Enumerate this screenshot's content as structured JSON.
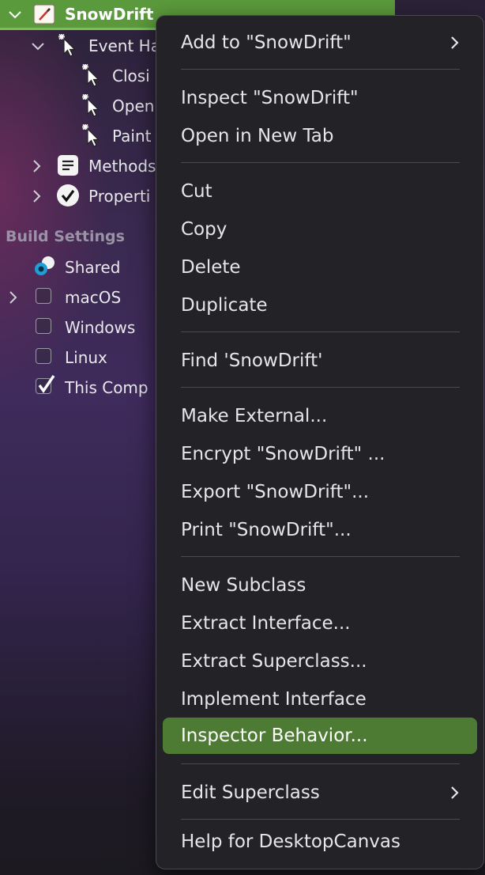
{
  "tree": {
    "project": "SnowDrift",
    "children": [
      {
        "label": "Event Ha"
      },
      {
        "label": "Closi"
      },
      {
        "label": "Open"
      },
      {
        "label": "Paint"
      },
      {
        "label": "Methods"
      },
      {
        "label": "Properti"
      }
    ],
    "build_settings_header": "Build Settings",
    "build_items": [
      {
        "label": "Shared",
        "checked": null
      },
      {
        "label": "macOS",
        "checked": false
      },
      {
        "label": "Windows",
        "checked": false
      },
      {
        "label": "Linux",
        "checked": false
      },
      {
        "label": "This Comp",
        "checked": true
      }
    ]
  },
  "context_menu": {
    "items": [
      {
        "label": "Add to \"SnowDrift\"",
        "submenu": true
      },
      {
        "label": "Inspect \"SnowDrift\""
      },
      {
        "label": "Open in New Tab"
      },
      {
        "label": "Cut"
      },
      {
        "label": "Copy"
      },
      {
        "label": "Delete"
      },
      {
        "label": "Duplicate"
      },
      {
        "label": "Find 'SnowDrift'"
      },
      {
        "label": "Make External..."
      },
      {
        "label": "Encrypt \"SnowDrift\"  ..."
      },
      {
        "label": "Export \"SnowDrift\"..."
      },
      {
        "label": "Print \"SnowDrift\"..."
      },
      {
        "label": "New Subclass"
      },
      {
        "label": "Extract Interface..."
      },
      {
        "label": "Extract Superclass..."
      },
      {
        "label": "Implement Interface"
      },
      {
        "label": "Inspector Behavior...",
        "highlighted": true
      },
      {
        "label": "Edit Superclass",
        "submenu": true
      },
      {
        "label": "Help for DesktopCanvas"
      }
    ]
  },
  "colors": {
    "selection": "#5b9a3c",
    "menu_highlight": "#4d7b33",
    "menu_background": "#232226"
  }
}
